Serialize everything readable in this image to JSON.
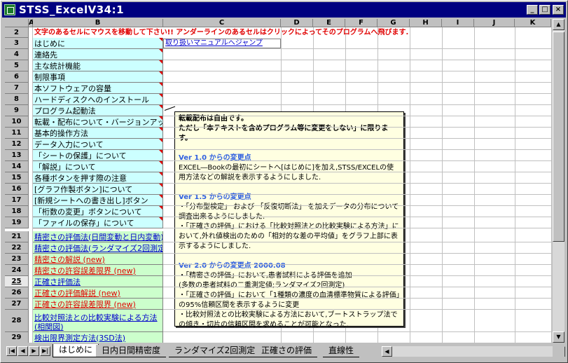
{
  "window": {
    "title": "STSS_ExcelV34:1",
    "min_glyph": "_",
    "max_glyph": "□",
    "close_glyph": "×"
  },
  "columns": [
    "A",
    "B",
    "C",
    "D",
    "E",
    "F",
    "G",
    "H",
    "I",
    "J",
    "K"
  ],
  "active_row": "25",
  "row2_text": "文字のあるセルにマウスを移動して下さい!! アンダーラインのあるセルはクリックによってそのプログラムへ飛びます.",
  "jump_link": "取り扱いマニュアルへジャンプ",
  "rows": [
    {
      "num": "3",
      "text": "はじめに",
      "style": "cyan"
    },
    {
      "num": "4",
      "text": "連絡先",
      "style": "cyan"
    },
    {
      "num": "5",
      "text": "主な統計機能",
      "style": "cyan"
    },
    {
      "num": "6",
      "text": "制限事項",
      "style": "cyan"
    },
    {
      "num": "7",
      "text": "本ソフトウェアの容量",
      "style": "cyan"
    },
    {
      "num": "8",
      "text": "ハードディスクへのインストール",
      "style": "cyan"
    },
    {
      "num": "9",
      "text": "プログラム起動法",
      "style": "cyan"
    },
    {
      "num": "10",
      "text": "転載・配布について・バージョンアップ",
      "style": "cyan"
    },
    {
      "num": "11",
      "text": "基本的操作方法",
      "style": "cyan"
    },
    {
      "num": "12",
      "text": "データ入力について",
      "style": "cyan"
    },
    {
      "num": "13",
      "text": "「シートの保護」について",
      "style": "cyan"
    },
    {
      "num": "14",
      "text": "「解説」について",
      "style": "cyan"
    },
    {
      "num": "15",
      "text": "各種ボタンを押す際の注意",
      "style": "cyan"
    },
    {
      "num": "16",
      "text": "[グラフ作製ボタン]について",
      "style": "cyan"
    },
    {
      "num": "17",
      "text": "[新規シートへの書き出し]ボタン",
      "style": "cyan"
    },
    {
      "num": "18",
      "text": "「桁数の変更」ボタンについて",
      "style": "cyan"
    },
    {
      "num": "19",
      "text": "「ファイルの保存」について",
      "style": "cyan"
    },
    {
      "num": "21",
      "text": "精密さの評価法(日間変動と日内変動)",
      "style": "green-link"
    },
    {
      "num": "22",
      "text": "精密さの評価法(ランダマイズ2回測定)",
      "style": "green-link"
    },
    {
      "num": "23",
      "text": "精密さの解説 (new)",
      "style": "green-red"
    },
    {
      "num": "24",
      "text": "精密さの許容誤差限界 (new)",
      "style": "green-red"
    },
    {
      "num": "25",
      "text": "正確さ評価法",
      "style": "green-link"
    },
    {
      "num": "26",
      "text": "正確さの評価解説 (new)",
      "style": "green-red"
    },
    {
      "num": "27",
      "text": "正確さの許容誤差限界 (new)",
      "style": "green-red"
    },
    {
      "num": "28",
      "text": "比較対照法との比較実験による方法(相関図)",
      "style": "green-link-tall"
    },
    {
      "num": "29",
      "text": "検出限界測定方法(3SD法)",
      "style": "green-link"
    }
  ],
  "comment": {
    "line1": "転載配布は自由です。",
    "line2": "ただし「本テキストを含めプログラム等に変更をしない」に限ります。",
    "v10_head": "Ver 1.0 からの変更点",
    "v10_body": "EXCEL―Bookの最初にシートへ[はじめに]を加え,STSS/EXCELの使用方法などの解説を表示するようにしました.",
    "v15_head": "Ver 1.5 からの変更点",
    "v15_body1": "・「分布型検定」 および 「反復切断法」 を加えデータの分布について調査出来るようにしました.",
    "v15_body2": "・「正確さの評価」における「比較対照法との比較実験による方法」において,外れ値検出のための「相対的な差の平均値」をグラフ上部に表示するようにしました.",
    "v20_head": "Ver 2.0 からの変更点 2000.08",
    "v20_body1": "・「精密さの評価」において,患者試料による評価を追加",
    "v20_body2": "(多数の患者試料の二重測定値;ランダマイズ2回測定)",
    "v20_body3": "・「正確さの評価」において「1種類の濃度の血清標準物質による評価」の95%信頼区間を表示するように変更",
    "v20_body4": "・比較対照法との比較実験による方法において,ブートストラップ法での傾き・切片の信頼区間を求めることが可能となった."
  },
  "tabs": [
    {
      "label": "はじめに",
      "active": true
    },
    {
      "label": "日内日間精密度",
      "active": false
    },
    {
      "label": "ランダマイズ2回測定",
      "active": false
    },
    {
      "label": "正確さの評価",
      "active": false
    },
    {
      "label": "直線性",
      "active": false
    }
  ],
  "colors": {
    "title_bg": "#000080",
    "cyan_cell": "#ccffff",
    "green_cell": "#ccffcc",
    "comment_bg": "#ffffe1",
    "red_text": "#e00000"
  }
}
